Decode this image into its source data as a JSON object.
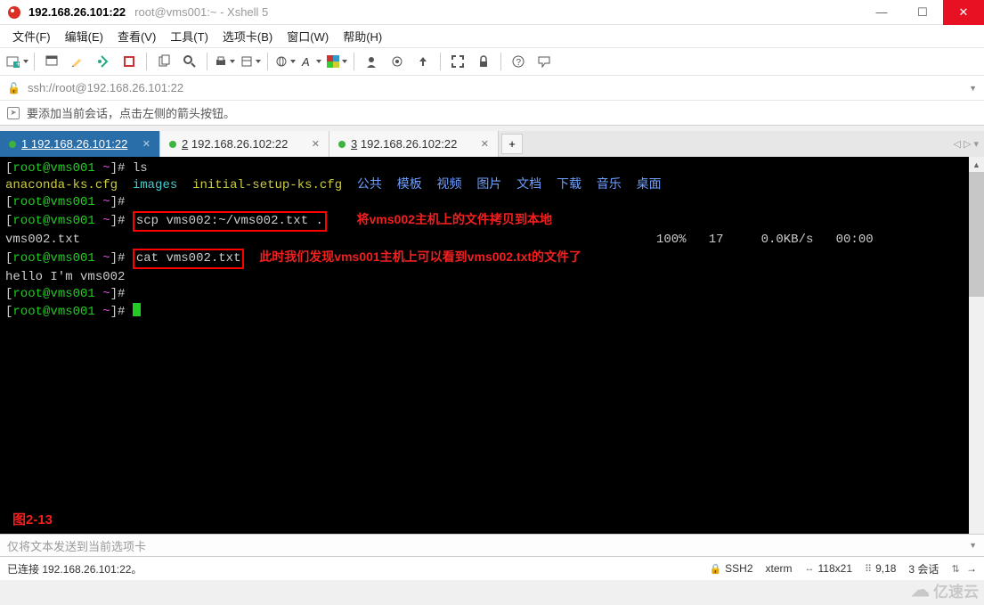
{
  "window": {
    "title_strong": "192.168.26.101:22",
    "title_weak": "root@vms001:~ - Xshell 5"
  },
  "menu": [
    "文件(F)",
    "编辑(E)",
    "查看(V)",
    "工具(T)",
    "选项卡(B)",
    "窗口(W)",
    "帮助(H)"
  ],
  "address": {
    "text": "ssh://root@192.168.26.101:22"
  },
  "tip": {
    "text": "要添加当前会话，点击左侧的箭头按钮。"
  },
  "tabs": [
    {
      "num": "1",
      "label": "192.168.26.101:22",
      "active": true,
      "connected": true
    },
    {
      "num": "2",
      "label": "192.168.26.102:22",
      "active": false,
      "connected": true
    },
    {
      "num": "3",
      "label": "192.168.26.102:22",
      "active": false,
      "connected": true
    }
  ],
  "terminal": {
    "prompt_user": "root@vms001",
    "prompt_path": "~",
    "prompt_symbol": "#",
    "lines": {
      "l1_cmd": "ls",
      "l2_file": "anaconda-ks.cfg",
      "l2_dir": "images",
      "l2_rest": "initial-setup-ks.cfg",
      "l2_cn": [
        "公共",
        "模板",
        "视频",
        "图片",
        "文档",
        "下载",
        "音乐",
        "桌面"
      ],
      "l4_cmd": "scp vms002:~/vms002.txt .",
      "l5_file": "vms002.txt",
      "l5_pct": "100%",
      "l5_size": "17",
      "l5_rate": "0.0KB/s",
      "l5_time": "00:00",
      "l6_cmd": "cat vms002.txt",
      "l7": "hello I'm vms002"
    },
    "annotations": {
      "scp": "将vms002主机上的文件拷贝到本地",
      "cat": "此时我们发现vms001主机上可以看到vms002.txt的文件了",
      "fig": "图2-13"
    }
  },
  "inputbar": {
    "placeholder": "仅将文本发送到当前选项卡"
  },
  "status": {
    "conn": "已连接 192.168.26.101:22。",
    "proto": "SSH2",
    "term": "xterm",
    "size": "118x21",
    "cursor": "9,18",
    "sess_label": "3 会话",
    "arrows": "⇅"
  },
  "watermark": "亿速云"
}
